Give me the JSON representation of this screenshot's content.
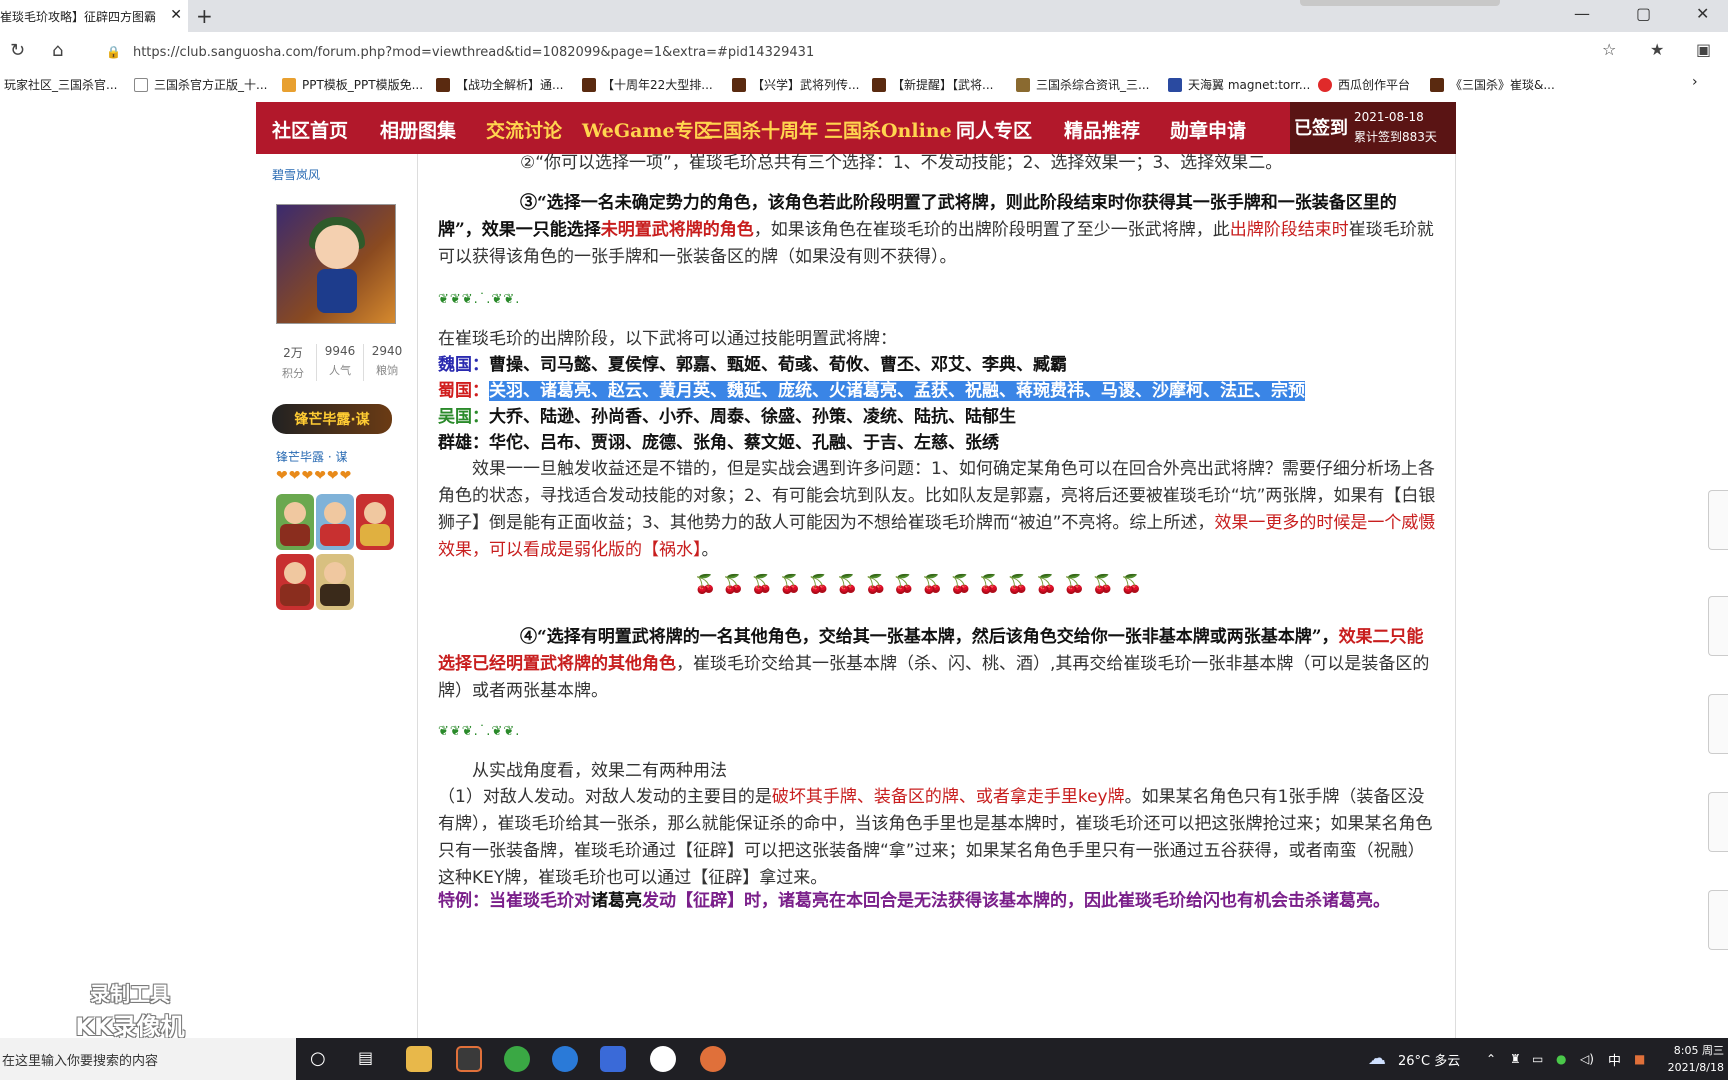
{
  "browser": {
    "tab_title": "崔琰毛玠攻略】征辟四方图霸",
    "tab_close": "✕",
    "new_tab": "+",
    "url": "https://club.sanguosha.com/forum.php?mod=viewthread&tid=1082099&page=1&extra=#pid14329431",
    "bookmarks": [
      "玩家社区_三国杀官...",
      "三国杀官方正版_十...",
      "PPT模板_PPT模版免...",
      "【战功全解析】通...",
      "【十周年22大型排...",
      "【兴学】武将列传...",
      "【新提醒】【武将...",
      "三国杀综合资讯_三...",
      "天海翼 magnet:torr...",
      "西瓜创作平台",
      "《三国杀》崔琰&..."
    ]
  },
  "nav": {
    "items": [
      "社区首页",
      "相册图集",
      "交流讨论",
      "WeGame专区",
      "三国杀十周年",
      "三国杀Online",
      "同人专区",
      "精品推荐",
      "勋章申请"
    ],
    "checkin_label": "已签到",
    "checkin_date": "2021-08-18",
    "checkin_count": "累计签到883天"
  },
  "user": {
    "name": "碧雪岚风",
    "stats": [
      {
        "value": "2万",
        "label": "积分"
      },
      {
        "value": "9946",
        "label": "人气"
      },
      {
        "value": "2940",
        "label": "粮饷"
      }
    ],
    "medal_text": "锋芒毕露·谋",
    "medal_name": "锋芒毕露 · 谋",
    "hearts": "❤❤❤❤❤❤"
  },
  "post": {
    "line1": "②“你可以选择一项”，崔琰毛玠总共有三个选择：1、不发动技能；2、选择效果一；3、选择效果二。",
    "p3_a": "③“选择一名未确定势力的角色，该角色若此阶段明置了武将牌，则此阶段结束时你获得其一张手牌和一张装备区里的牌”，效果一只能选择",
    "p3_b": "未明置武将牌的角色",
    "p3_c": "，如果该角色在崔琰毛玠的出牌阶段明置了至少一张武将牌，此",
    "p3_d": "出牌阶段结束时",
    "p3_e": "崔琰毛玠就可以获得该角色的一张手牌和一张装备区的牌（如果没有则不获得）。",
    "deco1": "❦❦❦.˙.❦❦.",
    "intro": "在崔琰毛玠的出牌阶段，以下武将可以通过技能明置武将牌：",
    "wei_label": "魏国：",
    "wei": "曹操、司马懿、夏侯惇、郭嘉、甄姬、荀彧、荀攸、曹丕、邓艾、李典、臧霸",
    "shu_label": "蜀国：",
    "shu": "关羽、诸葛亮、赵云、黄月英、魏延、庞统、火诸葛亮、孟获、祝融、蒋琬费祎、马谡、沙摩柯、法正、宗预",
    "wu_label": "吴国：",
    "wu": "大乔、陆逊、孙尚香、小乔、周泰、徐盛、孙策、凌统、陆抗、陆郁生",
    "qun_label": "群雄：",
    "qun": "华佗、吕布、贾诩、庞德、张角、蔡文姬、孔融、于吉、左慈、张绣",
    "eff1_a": "效果一一旦触发收益还是不错的，但是实战会遇到许多问题：1、如何确定某角色可以在回合外亮出武将牌？需要仔细分析场上各角色的状态，寻找适合发动技能的对象；2、有可能会坑到队友。比如队友是郭嘉，亮将后还要被崔琰毛玠“坑”两张牌，如果有【白银狮子】倒是能有正面收益；3、其他势力的敌人可能因为不想给崔琰毛玠牌而“被迫”不亮将。综上所述，",
    "eff1_b": "效果一更多的时候是一个威慑效果，可以看成是弱化版的【祸水】",
    "eff1_c": "。",
    "cherries": "🍒🍒🍒🍒🍒🍒🍒🍒🍒🍒🍒🍒🍒🍒🍒🍒",
    "p4_a": "④“选择有明置武将牌的一名其他角色，交给其一张基本牌，然后该角色交给你一张非基本牌或两张基本牌”，",
    "p4_b": "效果二只能选择已经明置武将牌的其他角色",
    "p4_c": "，崔琰毛玠交给其一张基本牌（杀、闪、桃、酒）,其再交给崔琰毛玠一张非基本牌（可以是装备区的牌）或者两张基本牌。",
    "deco2": "❦❦❦.˙.❦❦.",
    "eff2_intro": "从实战角度看，效果二有两种用法",
    "eff2_1a": "（1）对敌人发动。对敌人发动的主要目的是",
    "eff2_1b": "破坏其手牌、装备区的牌、或者拿走手里key牌",
    "eff2_1c": "。如果某名角色只有1张手牌（装备区没有牌），崔琰毛玠给其一张杀，那么就能保证杀的命中，当该角色手里也是基本牌时，崔琰毛玠还可以把这张牌抢过来；如果某名角色只有一张装备牌，崔琰毛玠通过【征辟】可以把这张装备牌“拿”过来；如果某名角色手里只有一张通过五谷获得，或者南蛮（祝融）这种KEY牌，崔琰毛玠也可以通过【征辟】拿过来。",
    "special_a": "特例：当崔琰毛玠对",
    "special_b": "诸葛亮",
    "special_c": "发动【征辟】时，诸葛亮在本回合是无法获得该基本牌的，因此崔琰毛玠给闪也有机会击杀诸葛亮。"
  },
  "watermark": {
    "line1": "录制工具",
    "line2": "KK录像机"
  },
  "taskbar": {
    "search_placeholder": "在这里输入你要搜索的内容",
    "weather": "26°C 多云",
    "ime": "中",
    "time": "8:05 周三",
    "date": "2021/8/18"
  }
}
